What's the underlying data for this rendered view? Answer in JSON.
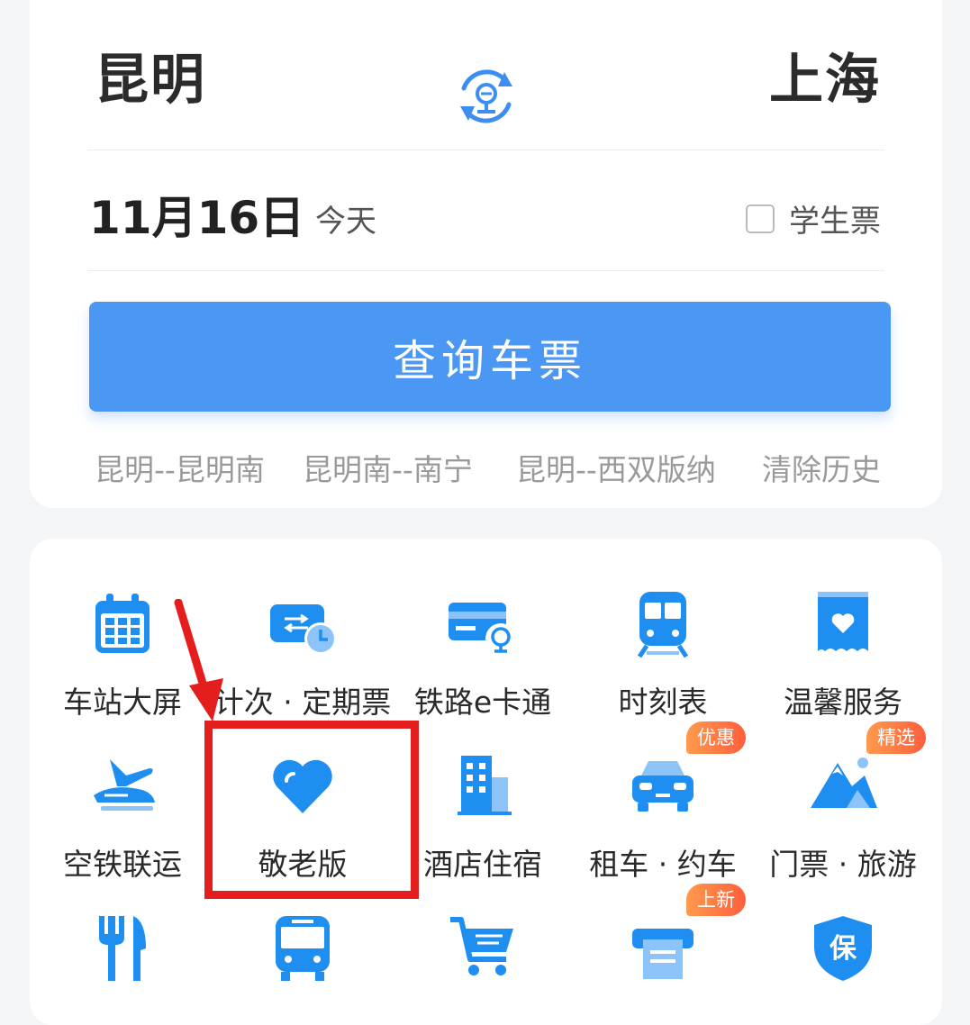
{
  "route": {
    "from": "昆明",
    "to": "上海"
  },
  "date": {
    "value": "11月16日",
    "relative": "今天"
  },
  "student_ticket": {
    "label": "学生票",
    "checked": false
  },
  "query_button": "查询车票",
  "history": [
    "昆明--昆明南",
    "昆明南--南宁",
    "昆明--西双版纳",
    "清除历史"
  ],
  "services": [
    {
      "label": "车站大屏",
      "icon": "calendar-grid-icon"
    },
    {
      "label": "计次 · 定期票",
      "icon": "ticket-clock-icon"
    },
    {
      "label": "铁路e卡通",
      "icon": "railway-card-icon"
    },
    {
      "label": "时刻表",
      "icon": "train-icon"
    },
    {
      "label": "温馨服务",
      "icon": "heart-box-icon"
    },
    {
      "label": "空铁联运",
      "icon": "plane-train-icon"
    },
    {
      "label": "敬老版",
      "icon": "heart-icon"
    },
    {
      "label": "酒店住宿",
      "icon": "hotel-building-icon"
    },
    {
      "label": "租车 · 约车",
      "icon": "car-icon",
      "badge": "优惠"
    },
    {
      "label": "门票 · 旅游",
      "icon": "mountain-icon",
      "badge": "精选"
    },
    {
      "label": "",
      "icon": "fork-knife-icon"
    },
    {
      "label": "",
      "icon": "bus-icon"
    },
    {
      "label": "",
      "icon": "shopping-cart-icon"
    },
    {
      "label": "",
      "icon": "printer-icon",
      "badge": "上新"
    },
    {
      "label": "",
      "icon": "insurance-shield-icon",
      "glyph": "保"
    }
  ],
  "colors": {
    "accent": "#4b98f4",
    "icon_blue": "#1f8ef1",
    "badge": "#ff6b3d",
    "highlight": "#e41d1d"
  }
}
